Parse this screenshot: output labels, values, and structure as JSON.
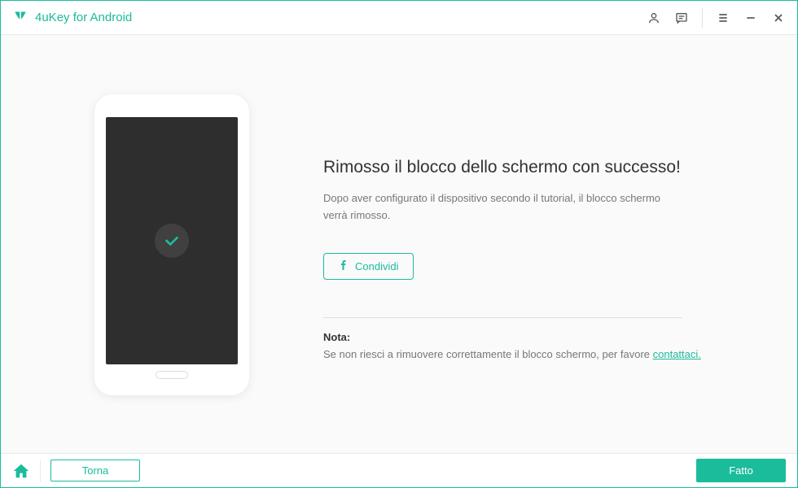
{
  "app": {
    "title": "4uKey for Android"
  },
  "main": {
    "heading": "Rimosso il blocco dello schermo con successo!",
    "subtext": "Dopo aver configurato il dispositivo secondo il tutorial, il blocco schermo verrà rimosso.",
    "share_label": "Condividi",
    "note_label": "Nota:",
    "note_text": "Se non riesci a rimuovere correttamente il blocco schermo, per favore ",
    "contact_link": "contattaci."
  },
  "footer": {
    "back_label": "Torna",
    "done_label": "Fatto"
  }
}
